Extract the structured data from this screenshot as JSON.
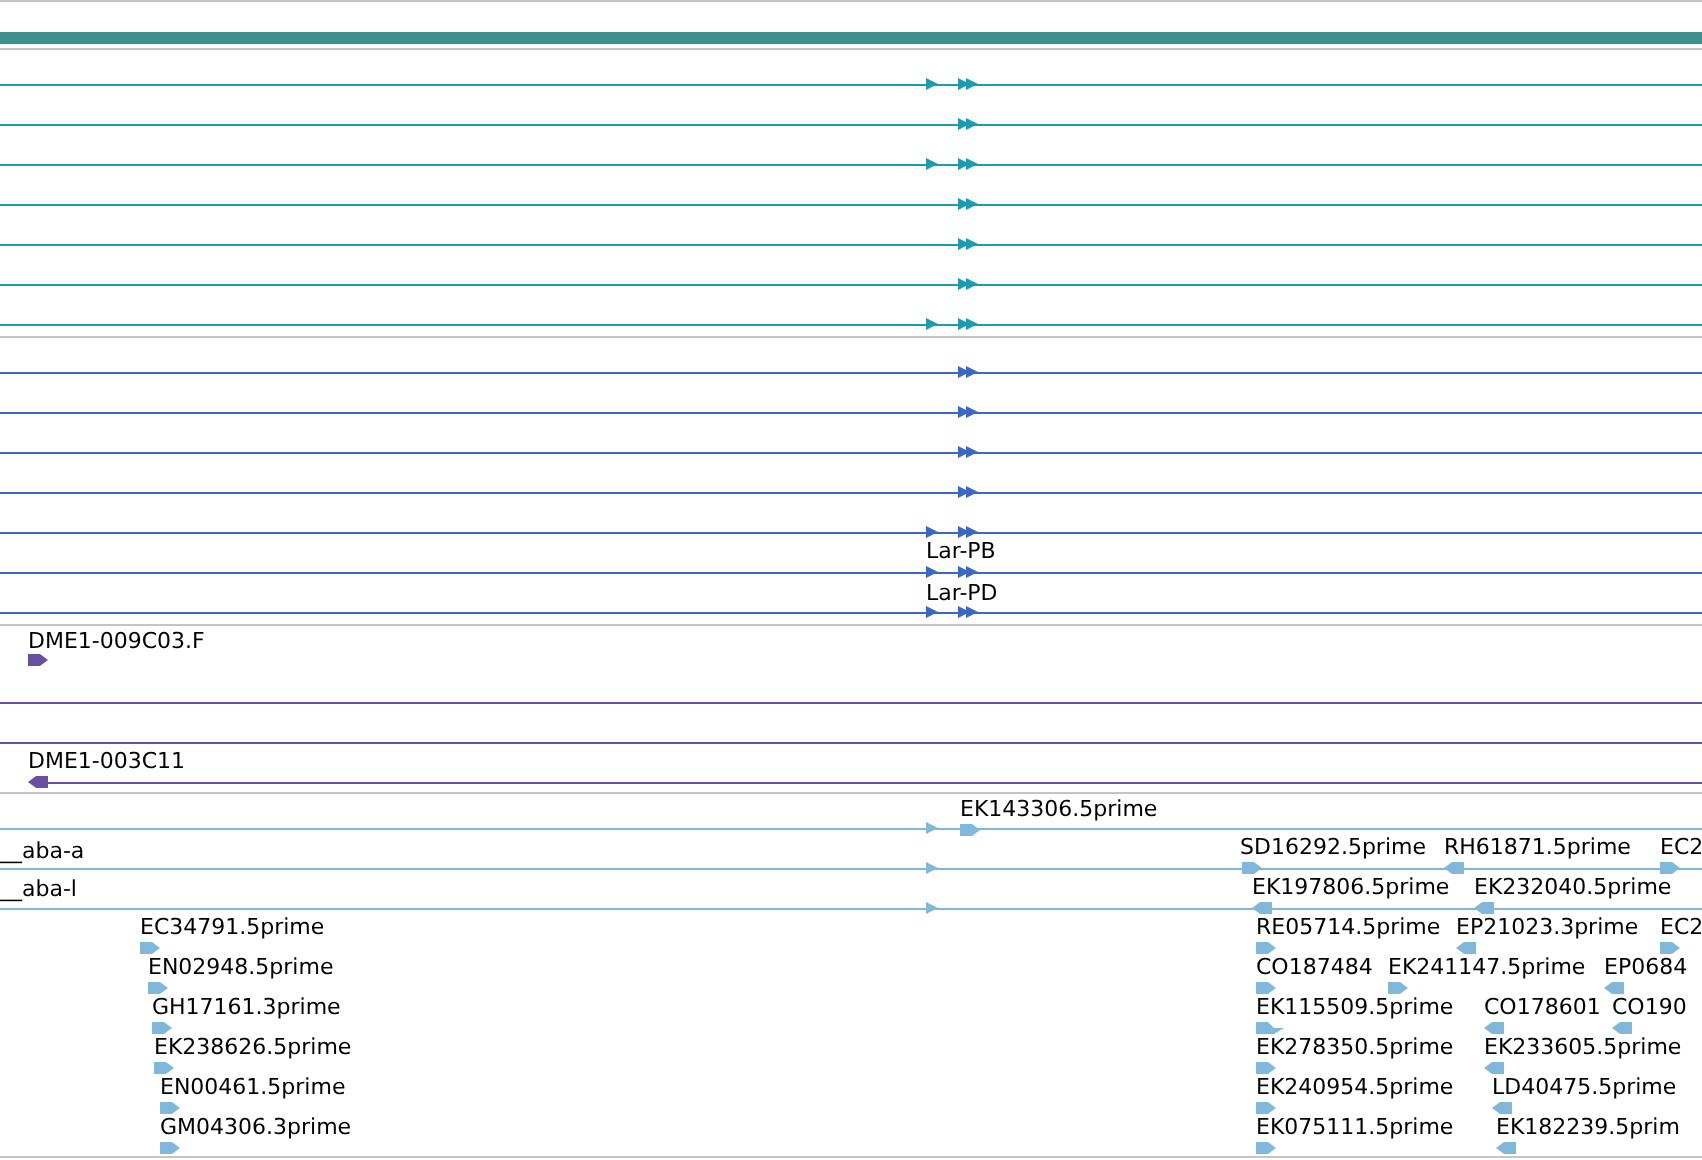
{
  "gene_track": {
    "color": "#3e9090"
  },
  "transcript_groups": [
    {
      "color": "#1b9cb3"
    },
    {
      "color": "#3a67c4",
      "labels": [
        "Lar-PB",
        "Lar-PD"
      ]
    }
  ],
  "clone_track": {
    "color": "#6a4fa0",
    "features": [
      {
        "label": "DME1-009C03.F",
        "reverse": false
      },
      {
        "label": "DME1-003C11",
        "reverse": true
      }
    ]
  },
  "est_track": {
    "color": "#80b8dc",
    "features": [
      {
        "label": "EK143306.5prime",
        "reverse": false
      },
      {
        "label": "__aba-a",
        "reverse": false
      },
      {
        "label": "__aba-l",
        "reverse": false
      },
      {
        "label": "EC34791.5prime",
        "reverse": false
      },
      {
        "label": "EN02948.5prime",
        "reverse": false
      },
      {
        "label": "GH17161.3prime",
        "reverse": false
      },
      {
        "label": "EK238626.5prime",
        "reverse": false
      },
      {
        "label": "EN00461.5prime",
        "reverse": false
      },
      {
        "label": "GM04306.3prime",
        "reverse": false
      },
      {
        "label": "SD16292.5prime",
        "reverse": false
      },
      {
        "label": "RH61871.5prime",
        "reverse": true
      },
      {
        "label": "EC2",
        "reverse": false
      },
      {
        "label": "EK197806.5prime",
        "reverse": true
      },
      {
        "label": "EK232040.5prime",
        "reverse": true
      },
      {
        "label": "RE05714.5prime",
        "reverse": false
      },
      {
        "label": "EP21023.3prime",
        "reverse": true
      },
      {
        "label": "EC2",
        "reverse": false
      },
      {
        "label": "CO187484",
        "reverse": false
      },
      {
        "label": "EK241147.5prime",
        "reverse": false
      },
      {
        "label": "EP0684",
        "reverse": true
      },
      {
        "label": "EK115509.5prime",
        "reverse": false
      },
      {
        "label": "CO178601",
        "reverse": true
      },
      {
        "label": "CO190",
        "reverse": true
      },
      {
        "label": "EK278350.5prime",
        "reverse": false
      },
      {
        "label": "EK233605.5prime",
        "reverse": true
      },
      {
        "label": "EK240954.5prime",
        "reverse": false
      },
      {
        "label": "LD40475.5prime",
        "reverse": true
      },
      {
        "label": "EK075111.5prime",
        "reverse": false
      },
      {
        "label": "EK182239.5prim",
        "reverse": true
      }
    ]
  }
}
